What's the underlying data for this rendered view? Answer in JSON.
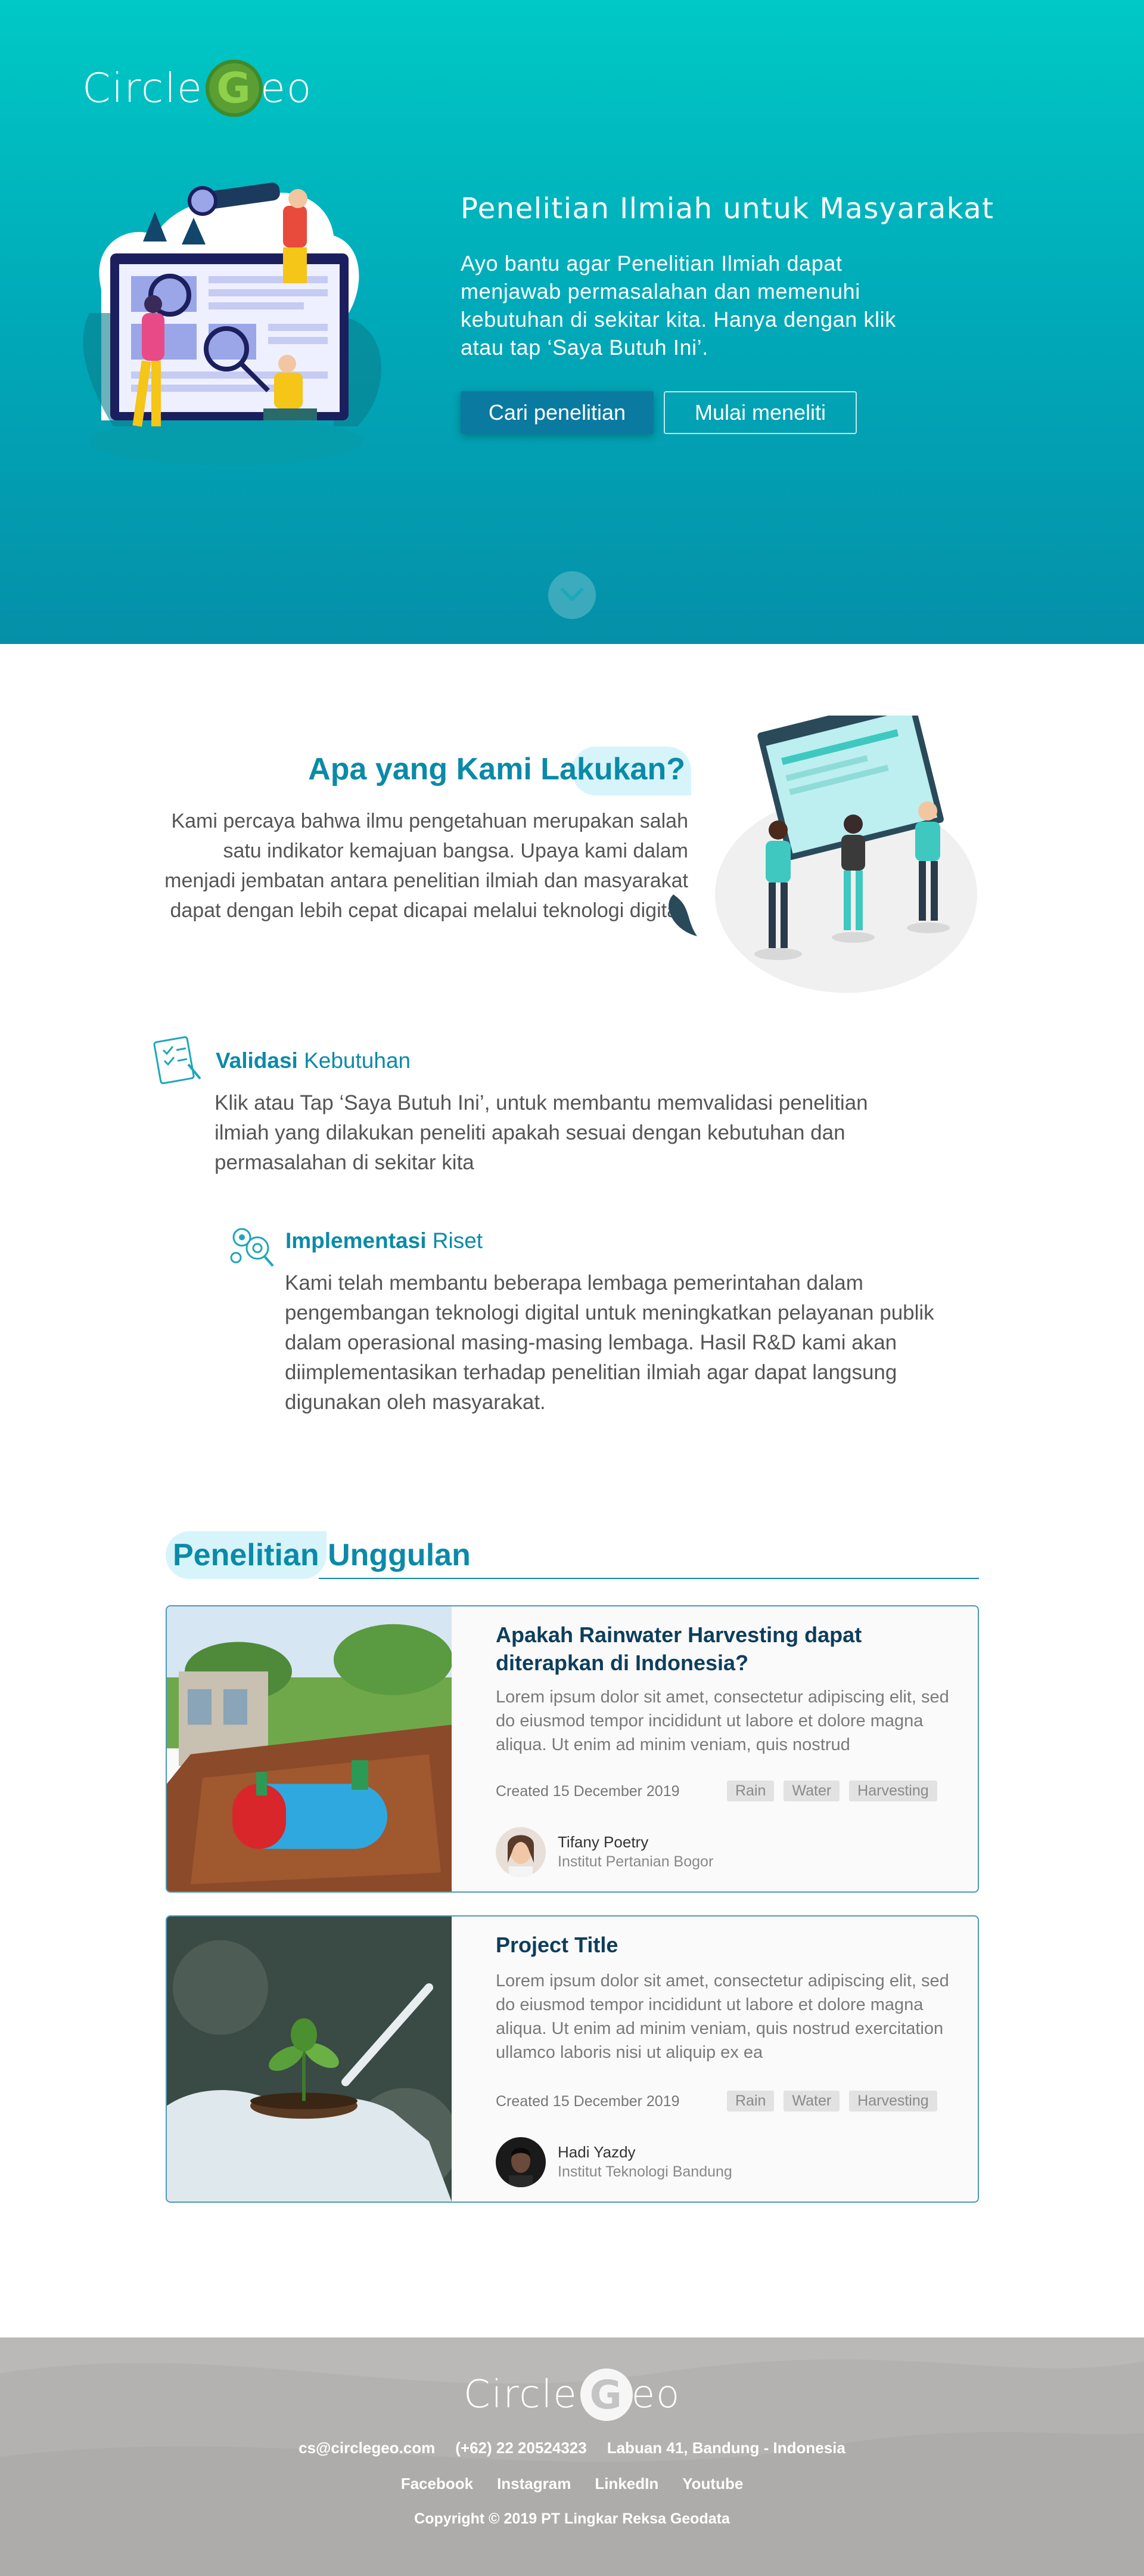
{
  "brand": {
    "name_part1": "Circle",
    "name_g": "G",
    "name_part2": "eo"
  },
  "hero": {
    "title": "Penelitian Ilmiah untuk Masyarakat",
    "description": "Ayo bantu agar Penelitian Ilmiah dapat menjawab permasalahan dan memenuhi kebutuhan di sekitar kita. Hanya dengan klik atau tap ‘Saya Butuh Ini’.",
    "primary_button": "Cari penelitian",
    "secondary_button": "Mulai meneliti"
  },
  "about": {
    "title_bold": "Apa yang",
    "title_rest": " Kami Lakukan?",
    "text": "Kami percaya bahwa ilmu pengetahuan merupakan salah satu indikator kemajuan bangsa. Upaya kami dalam menjadi jembatan antara penelitian ilmiah dan masyarakat dapat dengan lebih cepat dicapai melalui teknologi digital."
  },
  "features": [
    {
      "title_bold": "Validasi",
      "title_rest": " Kebutuhan",
      "icon": "checklist-icon",
      "description": "Klik atau Tap ‘Saya Butuh Ini’, untuk membantu memvalidasi penelitian ilmiah yang dilakukan peneliti apakah sesuai dengan kebutuhan dan permasalahan di sekitar kita"
    },
    {
      "title_bold": "Implementasi",
      "title_rest": " Riset",
      "icon": "research-gears-icon",
      "description": "Kami telah membantu beberapa lembaga pemerintahan dalam pengembangan teknologi digital untuk meningkatkan pelayanan publik dalam operasional masing-masing lembaga. Hasil R&D kami akan diimplementasikan terhadap penelitian ilmiah agar dapat langsung digunakan oleh masyarakat."
    }
  ],
  "featured": {
    "title_bold": "Penelitian",
    "title_rest": " Unggulan",
    "cards": [
      {
        "title": "Apakah Rainwater Harvesting dapat diterapkan di Indonesia?",
        "description": "Lorem ipsum dolor sit amet, consectetur adipiscing elit, sed do eiusmod tempor incididunt ut labore et dolore magna aliqua. Ut enim ad minim veniam, quis nostrud",
        "created": "Created 15 December 2019",
        "tags": [
          "Rain",
          "Water",
          "Harvesting"
        ],
        "author": "Tifany Poetry",
        "institution": "Institut Pertanian Bogor"
      },
      {
        "title": "Project Title",
        "description": "Lorem ipsum dolor sit amet, consectetur adipiscing elit, sed do eiusmod tempor incididunt ut labore et dolore magna aliqua. Ut enim ad minim veniam, quis nostrud exercitation ullamco laboris nisi ut aliquip ex ea",
        "created": "Created 15 December 2019",
        "tags": [
          "Rain",
          "Water",
          "Harvesting"
        ],
        "author": "Hadi Yazdy",
        "institution": "Institut Teknologi Bandung"
      }
    ]
  },
  "footer": {
    "email": "cs@circlegeo.com",
    "phone": "(+62) 22 20524323",
    "address": "Labuan 41, Bandung - Indonesia",
    "social": [
      "Facebook",
      "Instagram",
      "LinkedIn",
      "Youtube"
    ],
    "copyright": "Copyright © 2019 PT Lingkar Reksa Geodata"
  },
  "colors": {
    "accent": "#0b8aa8",
    "hero_top": "#00c9c6",
    "hero_bottom": "#0590a8",
    "primary_button": "#0b7aa0",
    "footer": "#b3b2b1"
  }
}
